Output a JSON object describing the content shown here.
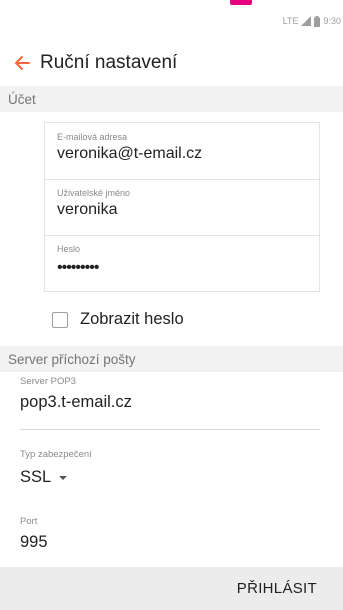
{
  "status": {
    "network": "LTE",
    "time": "9:30"
  },
  "header": {
    "title": "Ruční nastavení"
  },
  "account_section": {
    "label": "Účet"
  },
  "account": {
    "email": {
      "label": "E-mailová adresa",
      "value": "veronika@t-email.cz"
    },
    "username": {
      "label": "Uživatelské jméno",
      "value": "veronika"
    },
    "password": {
      "label": "Heslo",
      "value": "•••••••••"
    }
  },
  "show_password": {
    "label": "Zobrazit heslo",
    "checked": false
  },
  "incoming_section": {
    "label": "Server příchozí pošty"
  },
  "incoming": {
    "server": {
      "label": "Server POP3",
      "value": "pop3.t-email.cz"
    },
    "security": {
      "label": "Typ zabezpečení",
      "value": "SSL"
    },
    "port": {
      "label": "Port",
      "value": "995"
    }
  },
  "footer": {
    "login_label": "PŘIHLÁSIT"
  },
  "colors": {
    "accent_back_arrow": "#f2683c",
    "brand_top_mark": "#e6007e"
  }
}
